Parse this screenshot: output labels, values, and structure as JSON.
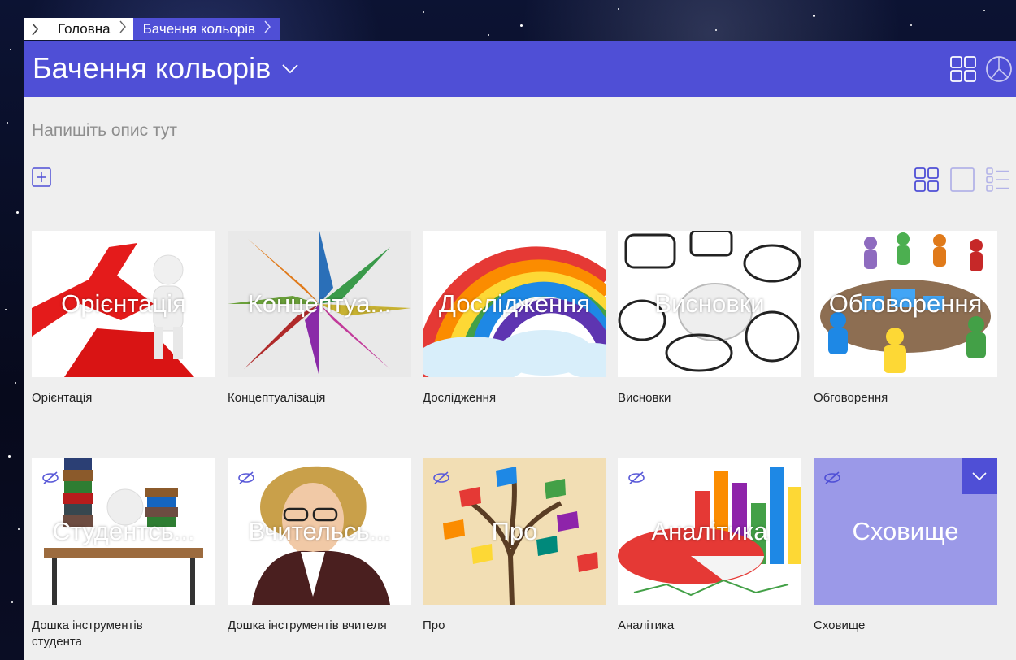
{
  "breadcrumb": {
    "home": "Головна",
    "current": "Бачення кольорів"
  },
  "header": {
    "title": "Бачення кольорів",
    "title_dropdown_icon": "chevron-down-icon",
    "grid_icon": "grid-icon",
    "pie_icon": "pie-chart-icon"
  },
  "main": {
    "description_placeholder": "Напишіть опис тут",
    "add_icon": "plus-box-icon",
    "view_toggles": [
      "grid-view-icon",
      "single-view-icon",
      "list-view-icon"
    ]
  },
  "tiles": [
    {
      "overlay": "Орієнтація",
      "caption": "Орієнтація",
      "hidden": false
    },
    {
      "overlay": "Концептуа...",
      "caption": "Концептуалізація",
      "hidden": false
    },
    {
      "overlay": "Дослідження",
      "caption": "Дослідження",
      "hidden": false
    },
    {
      "overlay": "Висновки",
      "caption": "Висновки",
      "hidden": false
    },
    {
      "overlay": "Обговорення",
      "caption": "Обговорення",
      "hidden": false
    },
    {
      "overlay": "Студентсь...",
      "caption": "Дошка інструментів студента",
      "hidden": true
    },
    {
      "overlay": "Вчительсь...",
      "caption": "Дошка інструментів вчителя",
      "hidden": true
    },
    {
      "overlay": "Про",
      "caption": "Про",
      "hidden": true
    },
    {
      "overlay": "Аналітика",
      "caption": "Аналітика",
      "hidden": true
    },
    {
      "overlay": "Сховище",
      "caption": "Сховище",
      "hidden": true
    }
  ],
  "colors": {
    "accent": "#4f4fd6",
    "background": "#efefef",
    "storage_tile": "#9b99e8"
  }
}
